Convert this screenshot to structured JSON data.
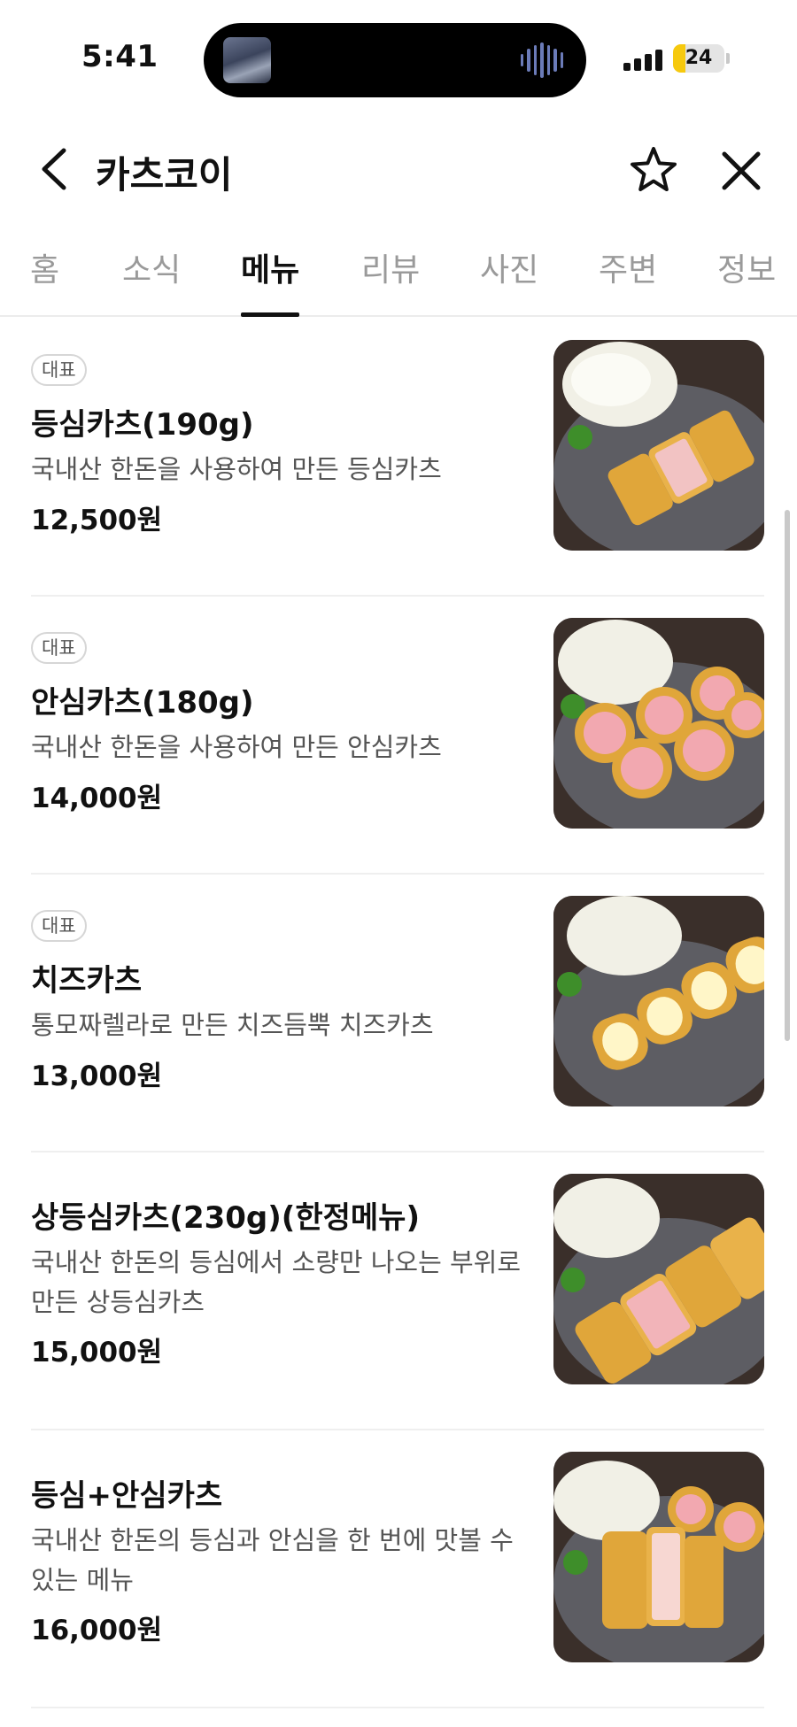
{
  "status_bar": {
    "time": "5:41",
    "battery": "24",
    "battery_level": 0.24
  },
  "header": {
    "title": "카츠코이"
  },
  "tabs": [
    {
      "label": "홈",
      "active": false
    },
    {
      "label": "소식",
      "active": false
    },
    {
      "label": "메뉴",
      "active": true
    },
    {
      "label": "리뷰",
      "active": false
    },
    {
      "label": "사진",
      "active": false
    },
    {
      "label": "주변",
      "active": false
    },
    {
      "label": "정보",
      "active": false
    }
  ],
  "menu": [
    {
      "badge": "대표",
      "name": "등심카츠(190g)",
      "description": "국내산 한돈을 사용하여 만든 등심카츠",
      "price": "12,500원"
    },
    {
      "badge": "대표",
      "name": "안심카츠(180g)",
      "description": "국내산 한돈을 사용하여 만든 안심카츠",
      "price": "14,000원"
    },
    {
      "badge": "대표",
      "name": "치즈카츠",
      "description": "통모짜렐라로 만든 치즈듬뿍 치즈카츠",
      "price": "13,000원"
    },
    {
      "badge": "",
      "name": "상등심카츠(230g)(한정메뉴)",
      "description": "국내산 한돈의 등심에서 소량만 나오는 부위로 만든 상등심카츠",
      "price": "15,000원"
    },
    {
      "badge": "",
      "name": "등심+안심카츠",
      "description": "국내산 한돈의 등심과 안심을 한 번에 맛볼 수 있는 메뉴",
      "price": "16,000원"
    }
  ],
  "icons": {
    "back": "chevron-left-icon",
    "favorite": "star-outline-icon",
    "close": "close-icon"
  }
}
